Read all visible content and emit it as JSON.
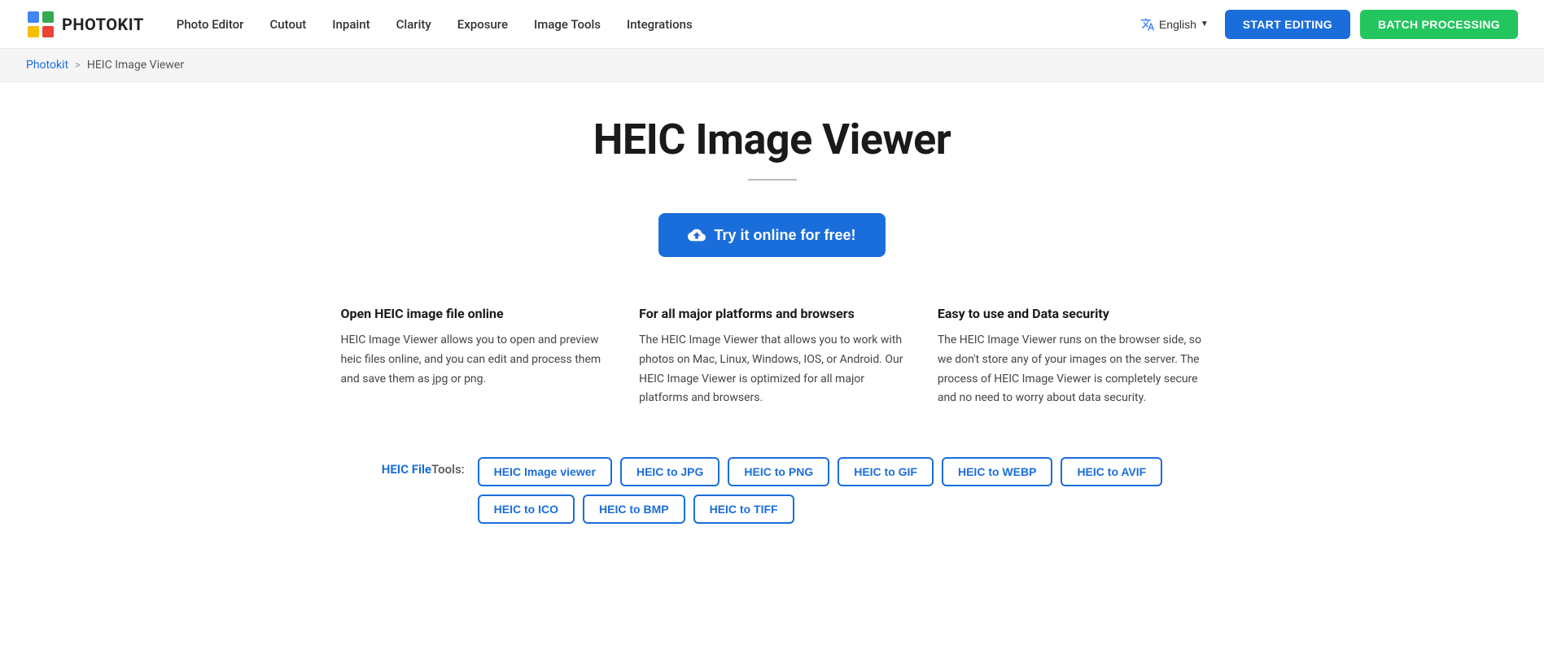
{
  "logo": {
    "text": "PHOTOKIT",
    "alt": "Photokit logo"
  },
  "nav": {
    "links": [
      {
        "label": "Photo Editor",
        "id": "nav-photo-editor"
      },
      {
        "label": "Cutout",
        "id": "nav-cutout"
      },
      {
        "label": "Inpaint",
        "id": "nav-inpaint"
      },
      {
        "label": "Clarity",
        "id": "nav-clarity"
      },
      {
        "label": "Exposure",
        "id": "nav-exposure"
      },
      {
        "label": "Image Tools",
        "id": "nav-image-tools"
      },
      {
        "label": "Integrations",
        "id": "nav-integrations"
      }
    ],
    "language_label": "English",
    "start_editing_label": "START EDITING",
    "batch_processing_label": "BATCH PROCESSING"
  },
  "breadcrumb": {
    "home_label": "Photokit",
    "separator": ">",
    "current_label": "HEIC Image Viewer"
  },
  "main": {
    "page_title": "HEIC Image Viewer",
    "cta_button": "Try it online for free!",
    "features": [
      {
        "title": "Open HEIC image file online",
        "description": "HEIC Image Viewer allows you to open and preview heic files online, and you can edit and process them and save them as jpg or png."
      },
      {
        "title": "For all major platforms and browsers",
        "description": "The HEIC Image Viewer that allows you to work with photos on Mac, Linux, Windows, IOS, or Android. Our HEIC Image Viewer is optimized for all major platforms and browsers."
      },
      {
        "title": "Easy to use and Data security",
        "description": "The HEIC Image Viewer runs on the browser side, so we don't store any of your images on the server. The process of HEIC Image Viewer is completely secure and no need to worry about data security."
      }
    ],
    "tools_label_heic": "HEIC File",
    "tools_label_rest": " Tools:",
    "tools_row1": [
      "HEIC Image viewer",
      "HEIC to JPG",
      "HEIC to PNG",
      "HEIC to GIF",
      "HEIC to WEBP",
      "HEIC to AVIF"
    ],
    "tools_row2": [
      "HEIC to ICO",
      "HEIC to BMP",
      "HEIC to TIFF"
    ]
  }
}
